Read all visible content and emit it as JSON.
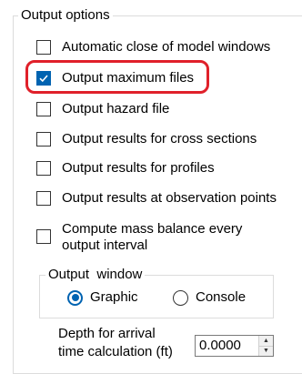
{
  "output_options": {
    "title": "Output options",
    "checkboxes": [
      {
        "label": "Automatic close of model windows",
        "checked": false
      },
      {
        "label": "Output maximum files",
        "checked": true
      },
      {
        "label": "Output hazard file",
        "checked": false
      },
      {
        "label": "Output results for cross sections",
        "checked": false
      },
      {
        "label": "Output results for profiles",
        "checked": false
      },
      {
        "label": "Output results at observation points",
        "checked": false
      },
      {
        "label": "Compute mass balance every output interval",
        "checked": false
      }
    ],
    "output_window": {
      "title": "Output  window",
      "options": [
        {
          "label": "Graphic",
          "selected": true
        },
        {
          "label": "Console",
          "selected": false
        }
      ]
    },
    "depth": {
      "label_line1": "Depth for arrival",
      "label_line2": "time calculation (ft)",
      "value": "0.0000"
    }
  },
  "colors": {
    "accent": "#0063b1",
    "highlight": "#e0202a",
    "border": "#dcdcdc"
  },
  "icons": {
    "checkmark": "checkmark-icon",
    "spin_up": "caret-up-icon",
    "spin_down": "caret-down-icon"
  }
}
